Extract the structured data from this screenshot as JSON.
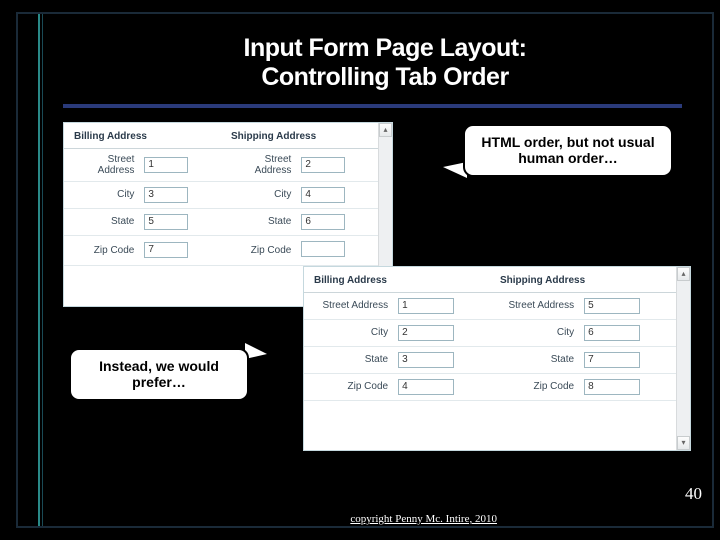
{
  "title_line1": "Input Form Page Layout:",
  "title_line2": "Controlling Tab Order",
  "callouts": {
    "html_order": "HTML order, but not usual human order…",
    "preferred": "Instead, we would prefer…"
  },
  "form": {
    "headers": {
      "billing": "Billing Address",
      "shipping": "Shipping Address"
    },
    "labels": {
      "street": "Street Address",
      "city": "City",
      "state": "State",
      "zip": "Zip Code"
    }
  },
  "form1_values": {
    "billing": {
      "street": "1",
      "city": "3",
      "state": "5",
      "zip": "7"
    },
    "shipping": {
      "street": "2",
      "city": "4",
      "state": "6",
      "zip": ""
    }
  },
  "form2_values": {
    "billing": {
      "street": "1",
      "city": "2",
      "state": "3",
      "zip": "4"
    },
    "shipping": {
      "street": "5",
      "city": "6",
      "state": "7",
      "zip": "8"
    }
  },
  "page_number": "40",
  "copyright": "copyright Penny Mc. Intire, 2010"
}
